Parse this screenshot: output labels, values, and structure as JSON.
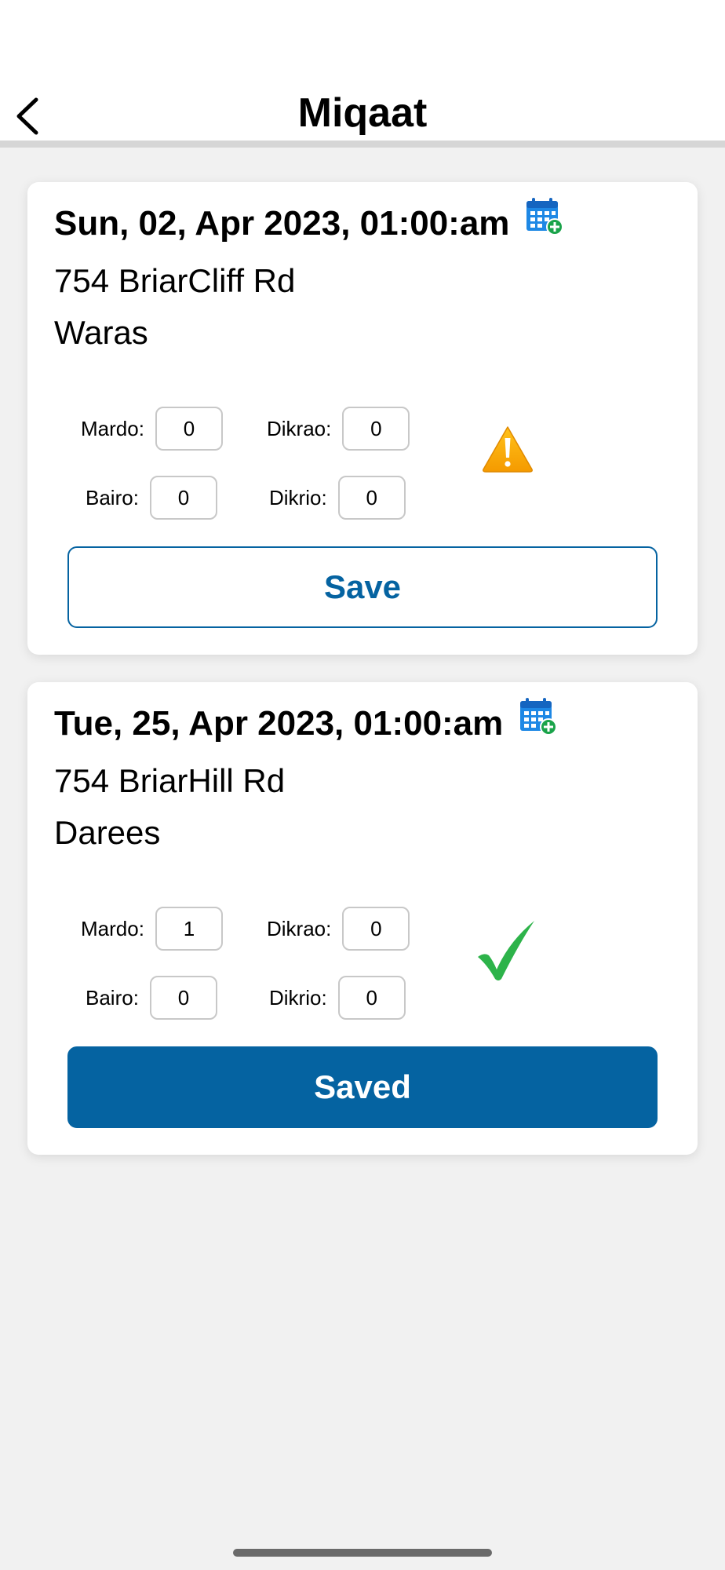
{
  "header": {
    "title": "Miqaat",
    "back_icon": "chevron-left-icon"
  },
  "colors": {
    "accent": "#0563a1",
    "success": "#2db34a",
    "warning": "#f5a300",
    "calendar": "#1e88e5",
    "calendar_plus": "#1aa34a"
  },
  "miqaats": [
    {
      "date": "Sun, 02, Apr 2023, 01:00:am",
      "address": "754 BriarCliff Rd",
      "type": "Waras",
      "fields": {
        "mardo_label": "Mardo:",
        "mardo_value": "0",
        "dikrao_label": "Dikrao:",
        "dikrao_value": "0",
        "bairo_label": "Bairo:",
        "bairo_value": "0",
        "dikrio_label": "Dikrio:",
        "dikrio_value": "0"
      },
      "status_icon": "warning-icon",
      "button_label": "Save"
    },
    {
      "date": "Tue, 25, Apr 2023, 01:00:am",
      "address": "754 BriarHill Rd",
      "type": "Darees",
      "fields": {
        "mardo_label": "Mardo:",
        "mardo_value": "1",
        "dikrao_label": "Dikrao:",
        "dikrao_value": "0",
        "bairo_label": "Bairo:",
        "bairo_value": "0",
        "dikrio_label": "Dikrio:",
        "dikrio_value": "0"
      },
      "status_icon": "checkmark-icon",
      "button_label": "Saved"
    }
  ]
}
